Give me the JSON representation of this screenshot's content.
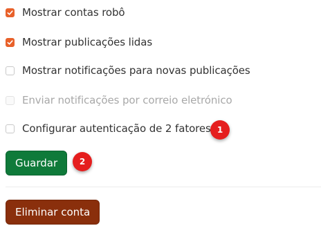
{
  "settings": {
    "options": [
      {
        "label": "Mostrar contas robô",
        "checked": true,
        "disabled": false
      },
      {
        "label": "Mostrar publicações lidas",
        "checked": true,
        "disabled": false
      },
      {
        "label": "Mostrar notificações para novas publicações",
        "checked": false,
        "disabled": false
      },
      {
        "label": "Enviar notificações por correio eletrónico",
        "checked": false,
        "disabled": true
      },
      {
        "label": "Configurar autenticação de 2 fatores",
        "checked": false,
        "disabled": false
      }
    ],
    "save_label": "Guardar",
    "delete_label": "Eliminar conta"
  },
  "markers": [
    "1",
    "2"
  ],
  "colors": {
    "accent": "#e8612a",
    "save_button": "#0f7a3a",
    "delete_button": "#8a2f0c",
    "marker": "#e51e1e"
  }
}
